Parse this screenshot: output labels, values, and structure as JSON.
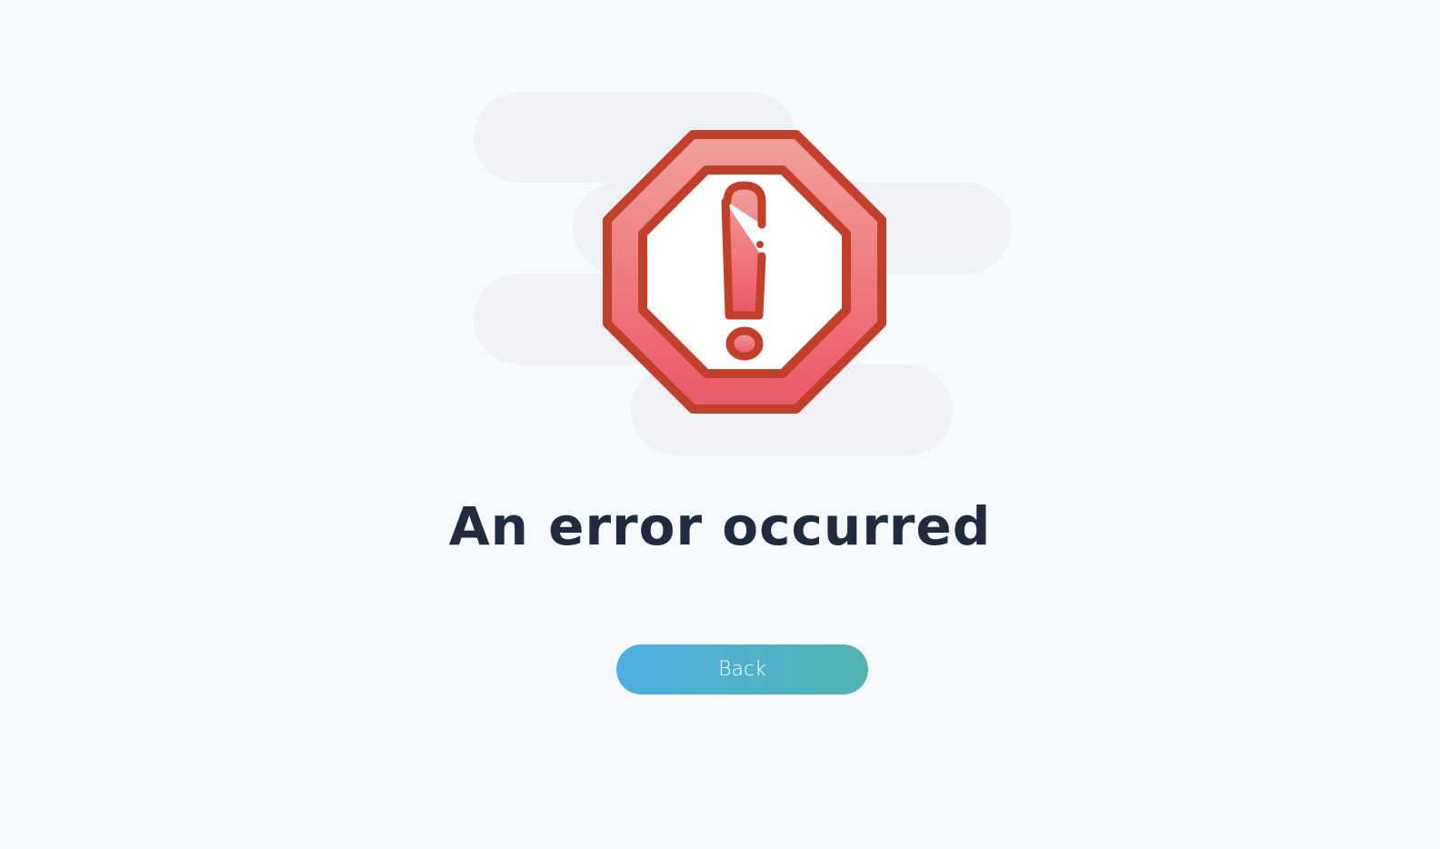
{
  "page": {
    "title": "An error occurred",
    "back_label": "Back",
    "icon": "error-octagon-exclamation-icon"
  },
  "colors": {
    "background": "#f6f9fd",
    "accent_start": "#4faee3",
    "accent_end": "#52b3b0",
    "icon_stroke": "#c0402a",
    "icon_fill": "#ec5a68",
    "title": "#222a40"
  }
}
